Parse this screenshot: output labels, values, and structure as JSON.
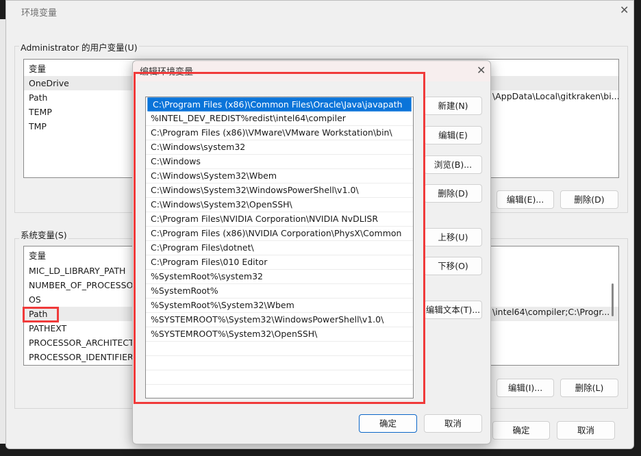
{
  "outer": {
    "title": "环境变量",
    "user_group_label": "Administrator 的用户变量(U)",
    "user_header": "变量",
    "user_vars": [
      "OneDrive",
      "Path",
      "TEMP",
      "TMP"
    ],
    "user_path_value": "\\AppData\\Local\\gitkraken\\bi...",
    "user_buttons": {
      "edit": "编辑(E)...",
      "delete": "删除(D)"
    },
    "sys_group_label": "系统变量(S)",
    "sys_header": "变量",
    "sys_vars": [
      "MIC_LD_LIBRARY_PATH",
      "NUMBER_OF_PROCESSOR",
      "OS",
      "Path",
      "PATHEXT",
      "PROCESSOR_ARCHITECT...",
      "PROCESSOR_IDENTIFIER"
    ],
    "sys_path_value": "\\intel64\\compiler;C:\\Progr...",
    "sys_buttons": {
      "edit": "编辑(I)...",
      "delete": "删除(L)"
    },
    "ok": "确定",
    "cancel": "取消"
  },
  "dialog": {
    "title": "编辑环境变量",
    "paths": [
      "C:\\Program Files (x86)\\Common Files\\Oracle\\Java\\javapath",
      "%INTEL_DEV_REDIST%redist\\intel64\\compiler",
      "C:\\Program Files (x86)\\VMware\\VMware Workstation\\bin\\",
      "C:\\Windows\\system32",
      "C:\\Windows",
      "C:\\Windows\\System32\\Wbem",
      "C:\\Windows\\System32\\WindowsPowerShell\\v1.0\\",
      "C:\\Windows\\System32\\OpenSSH\\",
      "C:\\Program Files\\NVIDIA Corporation\\NVIDIA NvDLISR",
      "C:\\Program Files (x86)\\NVIDIA Corporation\\PhysX\\Common",
      "C:\\Program Files\\dotnet\\",
      "C:\\Program Files\\010 Editor",
      "%SystemRoot%\\system32",
      "%SystemRoot%",
      "%SystemRoot%\\System32\\Wbem",
      "%SYSTEMROOT%\\System32\\WindowsPowerShell\\v1.0\\",
      "%SYSTEMROOT%\\System32\\OpenSSH\\"
    ],
    "buttons": {
      "new": "新建(N)",
      "edit": "编辑(E)",
      "browse": "浏览(B)...",
      "delete": "删除(D)",
      "up": "上移(U)",
      "down": "下移(O)",
      "edit_text": "编辑文本(T)..."
    },
    "ok": "确定",
    "cancel": "取消"
  },
  "colors": {
    "highlight": "#f03a3a",
    "selection": "#0a74d9"
  }
}
